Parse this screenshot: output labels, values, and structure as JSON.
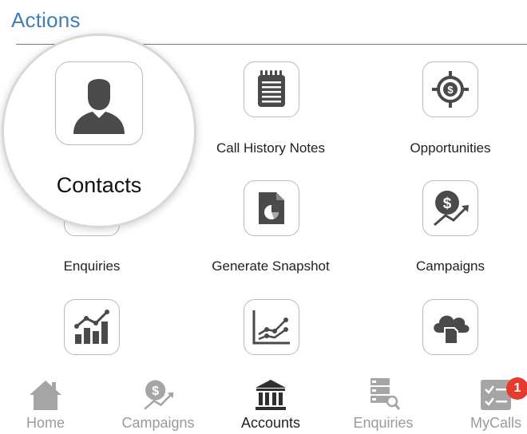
{
  "section": {
    "title": "Actions"
  },
  "actions": [
    {
      "label": "Contacts",
      "icon": "contact-person-icon"
    },
    {
      "label": "Call History Notes",
      "icon": "notepad-icon"
    },
    {
      "label": "Opportunities",
      "icon": "target-dollar-icon"
    },
    {
      "label": "Enquiries",
      "icon": "enquiry-search-icon"
    },
    {
      "label": "Generate Snapshot",
      "icon": "document-pie-icon"
    },
    {
      "label": "Campaigns",
      "icon": "dollar-growth-icon"
    },
    {
      "label": "",
      "icon": "bar-chart-icon"
    },
    {
      "label": "",
      "icon": "line-graph-icon"
    },
    {
      "label": "",
      "icon": "cloud-document-icon"
    }
  ],
  "tabbar": {
    "tabs": [
      {
        "label": "Home",
        "icon": "home-icon"
      },
      {
        "label": "Campaigns",
        "icon": "dollar-growth-icon"
      },
      {
        "label": "Accounts",
        "icon": "bank-icon"
      },
      {
        "label": "Enquiries",
        "icon": "enquiry-list-icon"
      },
      {
        "label": "MyCalls",
        "icon": "checklist-icon",
        "badge": "1"
      }
    ],
    "active": "Accounts"
  },
  "colors": {
    "title": "#3f7fb5",
    "icon": "#4a4a4a",
    "badge": "#e8392d"
  }
}
